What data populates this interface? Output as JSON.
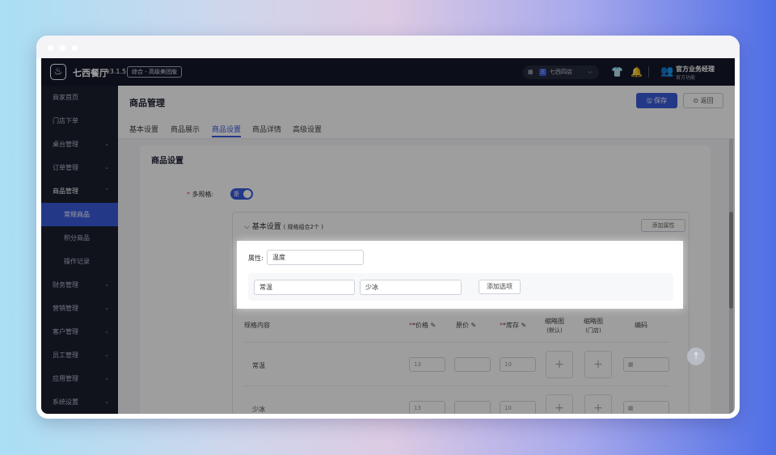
{
  "header": {
    "app_name": "七西餐厅",
    "version": "v3.1.5",
    "env_tag": "综合 - 高级美团版",
    "store_name": "七西四店",
    "store_brand_letter": "三",
    "user_name": "官方业务经理",
    "user_role": "官方功能"
  },
  "sidebar": {
    "items": [
      {
        "label": "商家首页",
        "chevron": ""
      },
      {
        "label": "门店下单",
        "chevron": ""
      },
      {
        "label": "桌台管理",
        "chevron": "⌄"
      },
      {
        "label": "订单管理",
        "chevron": "⌄"
      },
      {
        "label": "商品管理",
        "chevron": "⌃"
      },
      {
        "label": "常规商品",
        "chevron": ""
      },
      {
        "label": "积分商品",
        "chevron": ""
      },
      {
        "label": "操作记录",
        "chevron": ""
      },
      {
        "label": "财务管理",
        "chevron": "⌄"
      },
      {
        "label": "营销管理",
        "chevron": "⌄"
      },
      {
        "label": "客户管理",
        "chevron": "⌄"
      },
      {
        "label": "员工管理",
        "chevron": "⌄"
      },
      {
        "label": "应用管理",
        "chevron": "⌄"
      },
      {
        "label": "系统设置",
        "chevron": "⌄"
      }
    ]
  },
  "page": {
    "title": "商品管理",
    "save_label": "保存",
    "back_label": "返回",
    "tabs": [
      "基本设置",
      "商品展示",
      "商品设置",
      "商品详情",
      "高级设置"
    ],
    "active_tab": "商品设置"
  },
  "card": {
    "title": "商品设置",
    "multi_spec_label": "多规格:",
    "toggle_text": "是",
    "panel_title": "基本设置",
    "panel_subtitle": "( 规格组合2个 )",
    "add_attr_label": "添加属性",
    "attr_label": "属性:",
    "attr_value": "温度",
    "options": [
      "常温",
      "少冰"
    ],
    "add_option_label": "添加选项",
    "table_headers": [
      "规格内容",
      "*价格",
      "原价",
      "*库存",
      "缩略图",
      "缩略图",
      "编码"
    ],
    "table_subheaders": [
      "(默认)",
      "(门店)"
    ],
    "rows": [
      {
        "name": "常温",
        "price": "13",
        "original": "",
        "stock": "10"
      },
      {
        "name": "少冰",
        "price": "13",
        "original": "",
        "stock": "10"
      }
    ]
  },
  "colors": {
    "accent": "#3b5bdb",
    "sidebar_bg": "#1a1f2e",
    "header_bg": "#14192a"
  }
}
